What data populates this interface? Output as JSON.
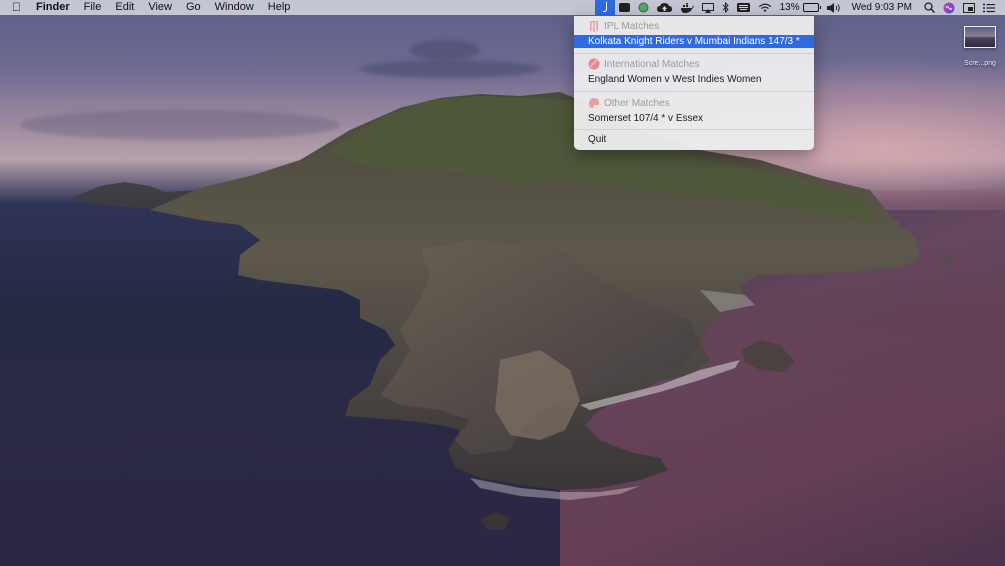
{
  "menubar": {
    "apple_icon": "apple-logo-icon",
    "app_name": "Finder",
    "menus": [
      "File",
      "Edit",
      "View",
      "Go",
      "Window",
      "Help"
    ],
    "status": {
      "battery_percent": "13%",
      "clock": "Wed 9:03 PM"
    }
  },
  "dropdown": {
    "sections": [
      {
        "header": "IPL Matches",
        "icon": "cricket-stumps-icon",
        "icon_color": "#e9a4a8",
        "items": [
          "Kolkata Knight Riders v Mumbai Indians 147/3 *"
        ]
      },
      {
        "header": "International Matches",
        "icon": "cricket-ball-icon",
        "icon_color": "#e58a8f",
        "items": [
          "England Women v West Indies Women"
        ]
      },
      {
        "header": "Other Matches",
        "icon": "cricket-helmet-icon",
        "icon_color": "#e8a0a4",
        "items": [
          "Somerset 107/4 * v Essex"
        ]
      }
    ],
    "quit_label": "Quit"
  },
  "desktop": {
    "file_label": "Scre...png"
  },
  "colors": {
    "selection": "#2f6ae0",
    "menubar_bg": "#dcdce4"
  }
}
